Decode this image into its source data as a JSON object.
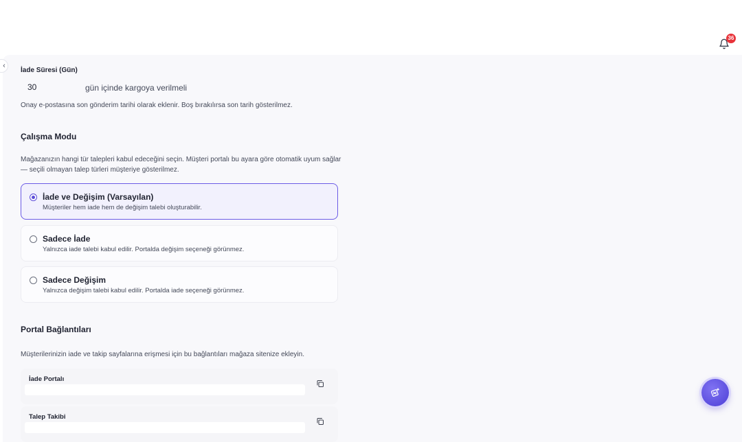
{
  "header": {
    "notification_count": "36",
    "bell_icon": "bell-icon"
  },
  "sidebar_toggle": {
    "glyph": "‹"
  },
  "return_period": {
    "label": "İade Süresi (Gün)",
    "value": "30",
    "suffix": "gün içinde kargoya verilmeli",
    "help": "Onay e-postasına son gönderim tarihi olarak eklenir. Boş bırakılırsa son tarih gösterilmez."
  },
  "work_mode": {
    "title": "Çalışma Modu",
    "description": "Mağazanızın hangi tür talepleri kabul edeceğini seçin. Müşteri portalı bu ayara göre otomatik uyum sağlar — seçili olmayan talep türleri müşteriye gösterilmez.",
    "options": [
      {
        "title": "İade ve Değişim (Varsayılan)",
        "description": "Müşteriler hem iade hem de değişim talebi oluşturabilir.",
        "selected": true
      },
      {
        "title": "Sadece İade",
        "description": "Yalnızca iade talebi kabul edilir. Portalda değişim seçeneği görünmez.",
        "selected": false
      },
      {
        "title": "Sadece Değişim",
        "description": "Yalnızca değişim talebi kabul edilir. Portalda iade seçeneği görünmez.",
        "selected": false
      }
    ]
  },
  "portal_links": {
    "title": "Portal Bağlantıları",
    "description": "Müşterilerinizin iade ve takip sayfalarına erişmesi için bu bağlantıları mağaza sitenize ekleyin.",
    "links": [
      {
        "label": "İade Portalı",
        "value": ""
      },
      {
        "label": "Talep Takibi",
        "value": ""
      }
    ]
  },
  "colors": {
    "accent": "#5b4bd8",
    "badge": "#e8333a",
    "selected_bg": "#f2f1fd"
  }
}
